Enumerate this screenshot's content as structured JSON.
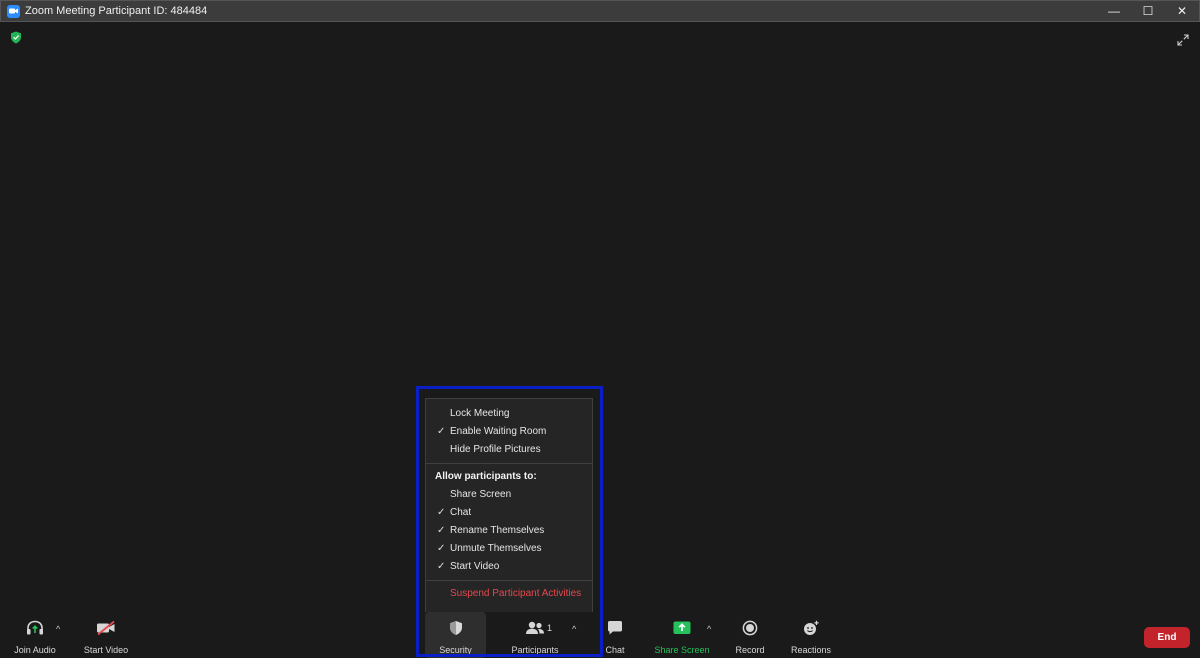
{
  "window": {
    "title": "Zoom Meeting Participant ID: 484484",
    "controls": {
      "minimize": "—",
      "maximize": "☐",
      "close": "✕"
    }
  },
  "security_menu": {
    "top_items": [
      {
        "label": "Lock Meeting",
        "checked": false
      },
      {
        "label": "Enable Waiting Room",
        "checked": true
      },
      {
        "label": "Hide Profile Pictures",
        "checked": false
      }
    ],
    "allow_heading": "Allow participants to:",
    "allow_items": [
      {
        "label": "Share Screen",
        "checked": false
      },
      {
        "label": "Chat",
        "checked": true
      },
      {
        "label": "Rename Themselves",
        "checked": true
      },
      {
        "label": "Unmute Themselves",
        "checked": true
      },
      {
        "label": "Start Video",
        "checked": true
      }
    ],
    "suspend_label": "Suspend Participant Activities",
    "check_glyph": "✓"
  },
  "toolbar": {
    "join_audio": "Join Audio",
    "start_video": "Start Video",
    "security": "Security",
    "participants": "Participants",
    "participants_count": "1",
    "chat": "Chat",
    "share_screen": "Share Screen",
    "record": "Record",
    "reactions": "Reactions",
    "end": "End",
    "caret": "^"
  },
  "colors": {
    "background": "#1a1a1a",
    "highlight_border": "#0b1fc7",
    "share_green": "#25c25c",
    "end_red": "#c3232b",
    "danger_text": "#e5484d",
    "zoom_blue": "#2d8cff"
  }
}
